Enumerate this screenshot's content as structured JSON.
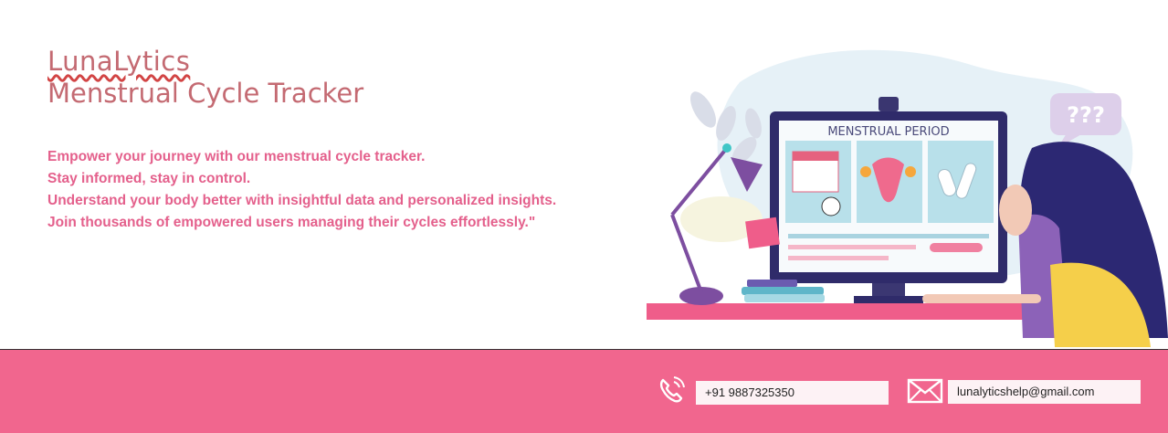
{
  "brand": {
    "name": "LunaLytics",
    "subtitle": "Menstrual Cycle Tracker"
  },
  "tagline": [
    "Empower your journey with our menstrual cycle tracker.",
    "Stay informed, stay in control.",
    "Understand your body better with insightful data and personalized insights.",
    "Join thousands of empowered users managing their cycles effortlessly.\""
  ],
  "illustration": {
    "screen_title": "MENSTRUAL PERIOD",
    "speech_bubble": "???"
  },
  "contact": {
    "phone": "+91 9887325350",
    "email": "lunalyticshelp@gmail.com"
  },
  "colors": {
    "footer": "#f1668e",
    "accent_pink": "#e4608c",
    "brand_text": "#c46a72"
  },
  "icons": {
    "phone": "phone-icon",
    "email": "mail-icon"
  }
}
